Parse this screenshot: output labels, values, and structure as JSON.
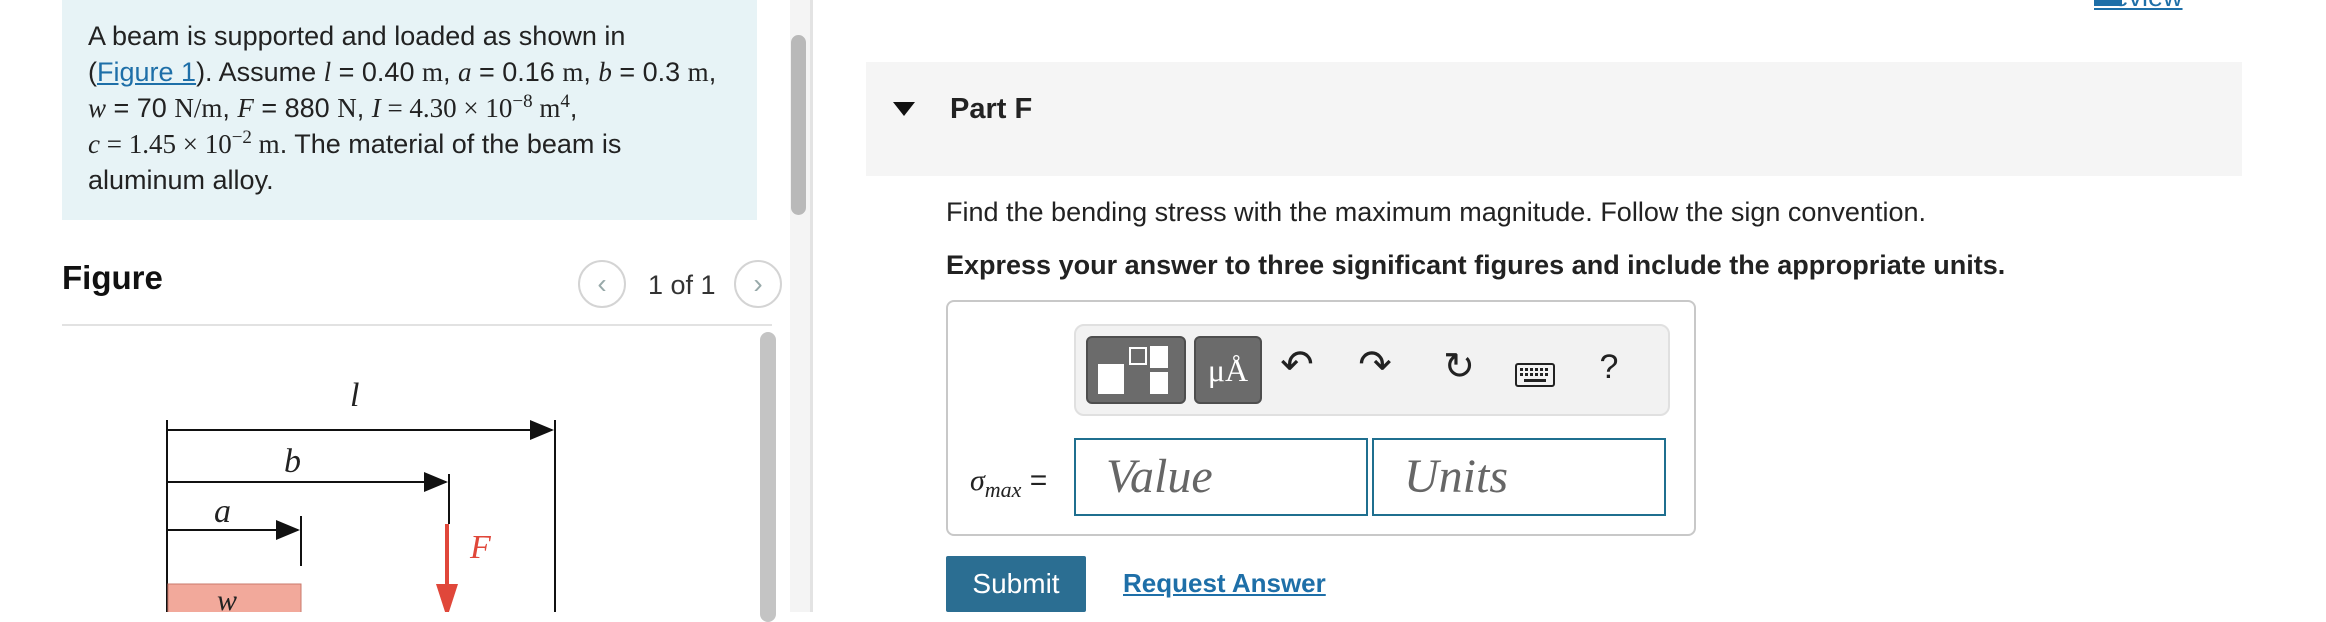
{
  "problem": {
    "line1": "A beam is supported and loaded as shown in",
    "line2_pre": "(",
    "figure_link": "Figure 1",
    "line2_post": "). Assume",
    "l_sym": "l",
    "l_val": " = 0.40 ",
    "m1": "m",
    "a_sym": "a",
    "a_val": " = 0.16 ",
    "m2": "m",
    "b_sym": "b",
    "b_val": " = 0.3 ",
    "m3": "m",
    "w_sym": "w",
    "w_val": " = 70 ",
    "w_unit": "N/m",
    "F_sym": "F",
    "F_val": " = 880 ",
    "F_unit": "N",
    "I_sym": "I",
    "I_val": " = 4.30 × 10",
    "I_exp": "−8",
    "I_unit": " m",
    "I_unit_exp": "4",
    "c_sym": "c",
    "c_val": " = 1.45 × 10",
    "c_exp": "−2",
    "c_unit": " m",
    "line4_tail": ". The material of the beam is",
    "line5": "aluminum alloy."
  },
  "figure": {
    "title": "Figure",
    "prev_icon": "chevron-left-icon",
    "next_icon": "chevron-right-icon",
    "counter": "1 of 1",
    "label_l": "l",
    "label_b": "b",
    "label_a": "a",
    "label_F": "F",
    "label_w": "w",
    "load_color": "#f2a99b",
    "force_color": "#e0473a"
  },
  "header": {
    "review": "Review"
  },
  "part": {
    "title": "Part F",
    "question": "Find the bending stress with the maximum magnitude. Follow the sign convention.",
    "instructions": "Express your answer to three significant figures and include the appropriate units."
  },
  "toolbar": {
    "templates_icon": "templates-icon",
    "units_label": "μÅ",
    "undo_icon": "↶",
    "redo_icon": "↷",
    "reset_icon": "↻",
    "keyboard_icon": "keyboard-icon",
    "help_label": "?"
  },
  "answer": {
    "sigma": "σ",
    "sigma_sub": "max",
    "equals": " =",
    "value_placeholder": "Value",
    "units_placeholder": "Units"
  },
  "actions": {
    "submit": "Submit",
    "request_answer": "Request Answer"
  }
}
